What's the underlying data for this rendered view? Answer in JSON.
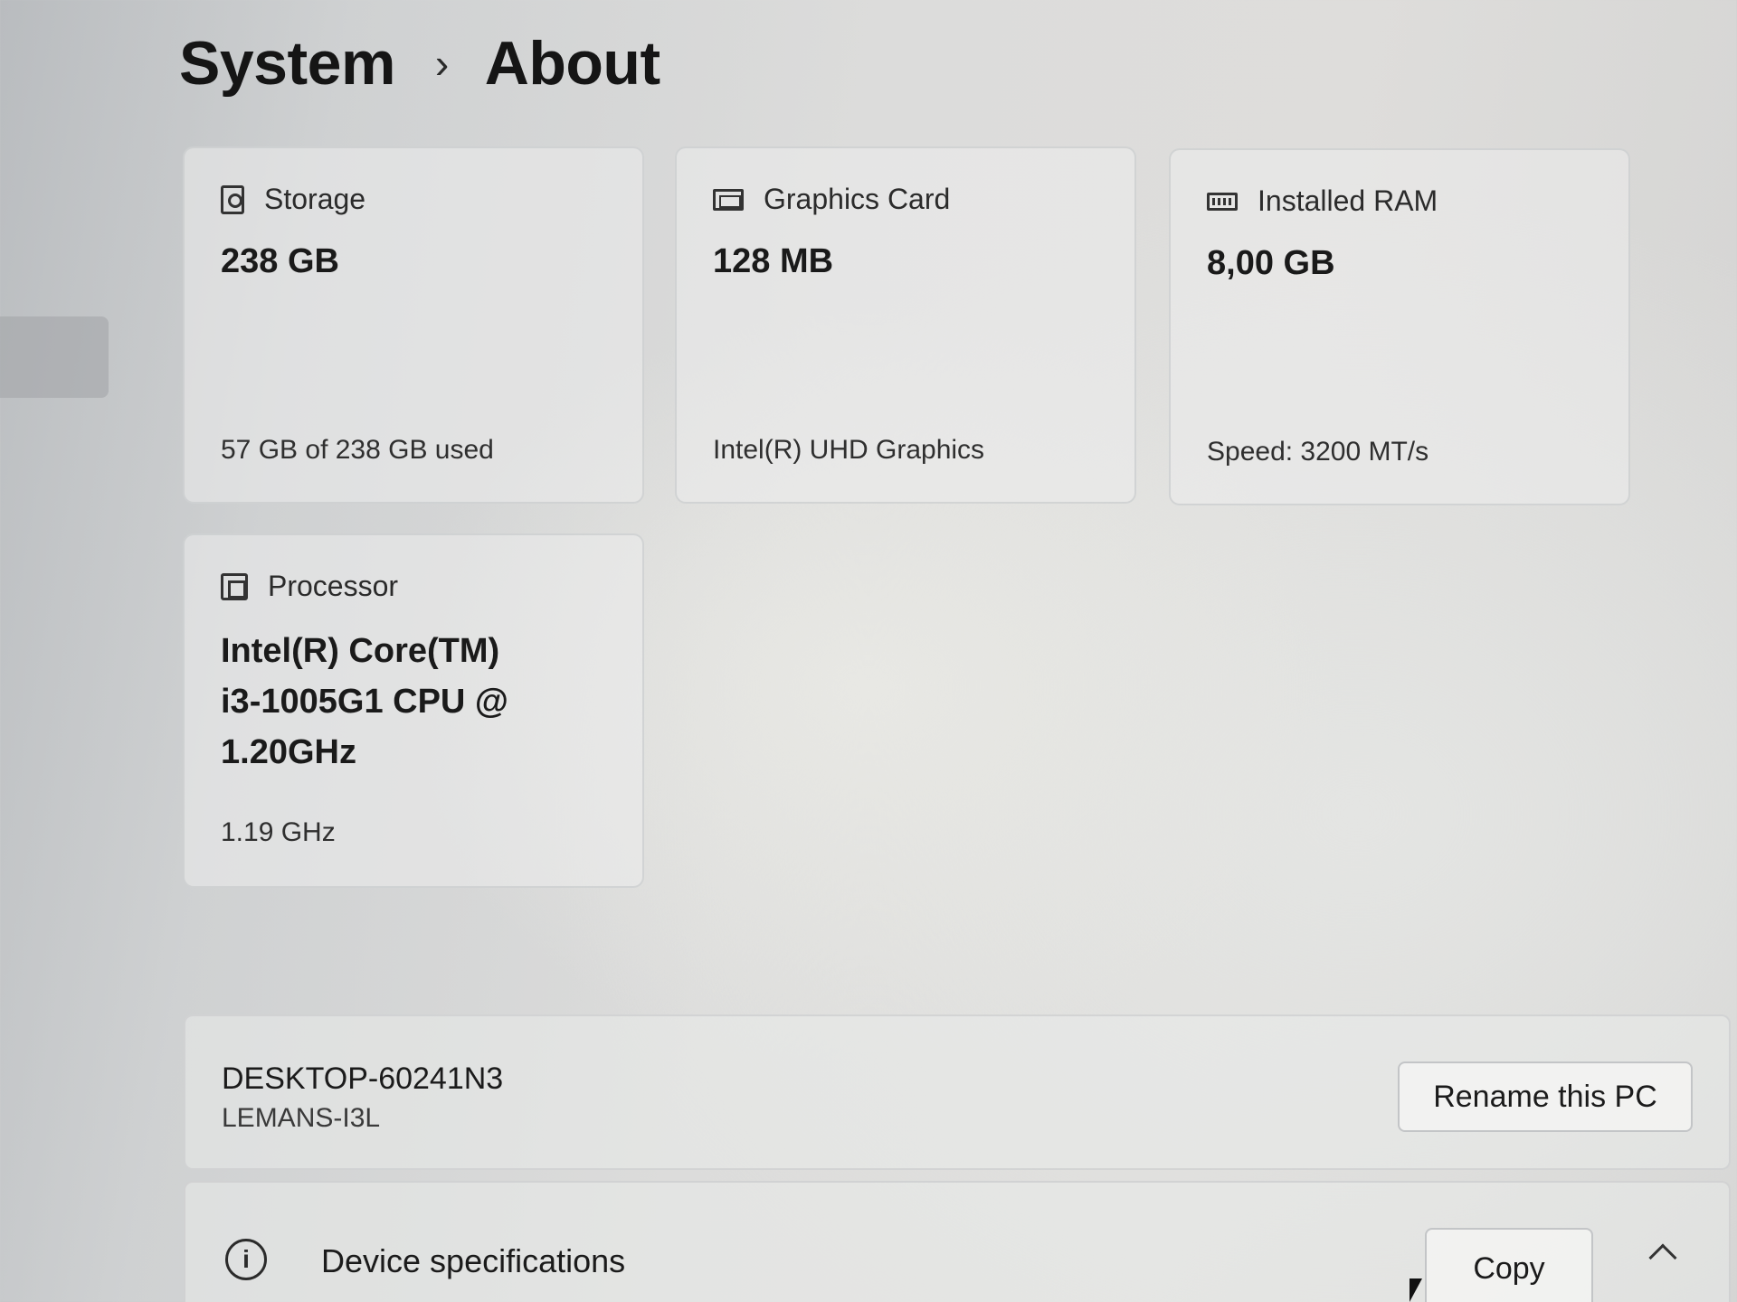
{
  "breadcrumb": {
    "parent": "System",
    "separator": "›",
    "current": "About"
  },
  "cards": {
    "storage": {
      "title": "Storage",
      "value": "238 GB",
      "sub": "57 GB of 238 GB used",
      "icon": "storage-icon"
    },
    "graphics": {
      "title": "Graphics Card",
      "value": "128 MB",
      "sub": "Intel(R) UHD Graphics",
      "icon": "graphics-card-icon"
    },
    "ram": {
      "title": "Installed RAM",
      "value": "8,00 GB",
      "sub": "Speed: 3200 MT/s",
      "icon": "ram-icon"
    },
    "processor": {
      "title": "Processor",
      "value_line1": "Intel(R) Core(TM)",
      "value_line2": "i3-1005G1 CPU @",
      "value_line3": "1.20GHz",
      "sub": "1.19 GHz",
      "icon": "processor-icon"
    }
  },
  "device": {
    "name": "DESKTOP-60241N3",
    "model": "LEMANS-I3L",
    "rename_label": "Rename this PC"
  },
  "specs": {
    "label": "Device specifications",
    "copy_label": "Copy",
    "info_icon": "i"
  }
}
